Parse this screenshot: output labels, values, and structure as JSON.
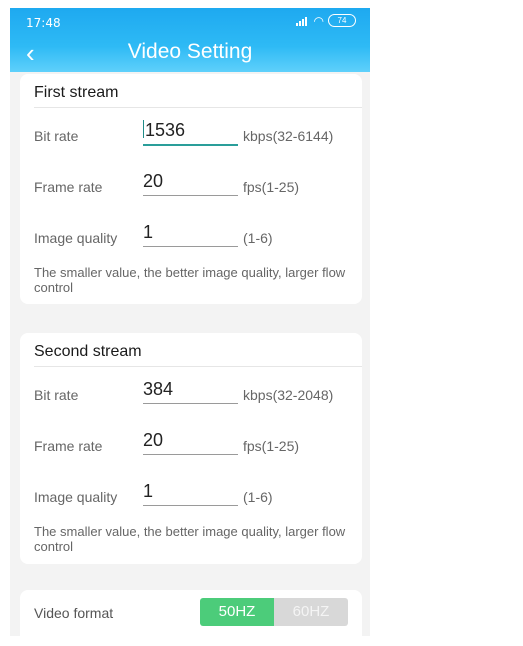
{
  "status_bar": {
    "time": "17:48",
    "signal_label": "4G",
    "battery": "74"
  },
  "header": {
    "title": "Video Setting"
  },
  "first_stream": {
    "title": "First stream",
    "bit_rate": {
      "label": "Bit rate",
      "value": "1536",
      "unit": "kbps(32-6144)"
    },
    "frame_rate": {
      "label": "Frame rate",
      "value": "20",
      "unit": "fps(1-25)"
    },
    "image_quality": {
      "label": "Image quality",
      "value": "1",
      "unit": "(1-6)"
    },
    "note": "The smaller value, the better image quality, larger flow control"
  },
  "second_stream": {
    "title": "Second stream",
    "bit_rate": {
      "label": "Bit rate",
      "value": "384",
      "unit": "kbps(32-2048)"
    },
    "frame_rate": {
      "label": "Frame rate",
      "value": "20",
      "unit": "fps(1-25)"
    },
    "image_quality": {
      "label": "Image quality",
      "value": "1",
      "unit": "(1-6)"
    },
    "note": "The smaller value, the better image quality, larger flow control"
  },
  "video_format": {
    "label": "Video format",
    "options": [
      "50HZ",
      "60HZ"
    ],
    "selected": "50HZ"
  },
  "colors": {
    "accent": "#29b5f4",
    "selected": "#4ccc7a",
    "unselected": "#d8d8d8",
    "input_focus": "#2a9e9a"
  }
}
